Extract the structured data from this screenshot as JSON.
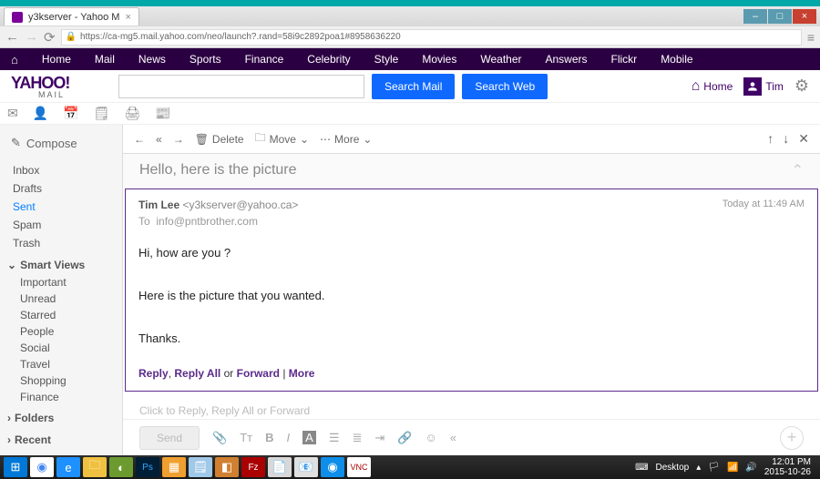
{
  "window": {
    "tab_title": "y3kserver - Yahoo M",
    "url": "https://ca-mg5.mail.yahoo.com/neo/launch?.rand=58i9c2892poa1#8958636220"
  },
  "topnav": {
    "home": "Home",
    "items": [
      "Mail",
      "News",
      "Sports",
      "Finance",
      "Celebrity",
      "Style",
      "Movies",
      "Weather",
      "Answers",
      "Flickr",
      "Mobile"
    ]
  },
  "logo": {
    "brand": "YAHOO!",
    "sub": "MAIL"
  },
  "search": {
    "mail_btn": "Search Mail",
    "web_btn": "Search Web",
    "placeholder": ""
  },
  "user": {
    "home": "Home",
    "name": "Tim"
  },
  "compose": "Compose",
  "folders": [
    "Inbox",
    "Drafts",
    "Sent",
    "Spam",
    "Trash"
  ],
  "active_folder": "Sent",
  "smart_views": {
    "header": "Smart Views",
    "items": [
      "Important",
      "Unread",
      "Starred",
      "People",
      "Social",
      "Travel",
      "Shopping",
      "Finance"
    ]
  },
  "collapsed": {
    "folders": "Folders",
    "recent": "Recent"
  },
  "toolbar": {
    "delete": "Delete",
    "move": "Move",
    "more": "More"
  },
  "subject": "Hello, here is the picture",
  "message": {
    "from_name": "Tim Lee",
    "from_email": "<y3kserver@yahoo.ca>",
    "to_label": "To",
    "to_email": "info@pntbrother.com",
    "time": "Today at 11:49 AM",
    "body_line1": "Hi, how are you ?",
    "body_line2": "Here is the picture that you wanted.",
    "body_line3": "Thanks.",
    "reply": "Reply",
    "reply_all": "Reply All",
    "or": "or",
    "forward": "Forward",
    "sep": "|",
    "more": "More"
  },
  "reply_hint": "Click to Reply, Reply All or Forward",
  "send": "Send",
  "tray": {
    "desktop": "Desktop",
    "time": "12:01 PM",
    "date": "2015-10-26"
  }
}
